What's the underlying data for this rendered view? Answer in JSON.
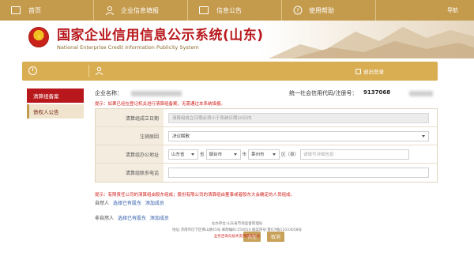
{
  "nav": {
    "items": [
      {
        "label": "首页",
        "icon": "home-icon"
      },
      {
        "label": "企业信息填报",
        "icon": "person-icon"
      },
      {
        "label": "信息公告",
        "icon": "document-icon"
      },
      {
        "label": "使用帮助",
        "icon": "help-icon"
      }
    ],
    "right_label": "导航"
  },
  "banner": {
    "title_cn": "国家企业信用信息公示系统(山东)",
    "title_en": "National Enterprise Credit Information Publicity System"
  },
  "goldbar": {
    "logout_label": "退出登录"
  },
  "sidebar": {
    "items": [
      {
        "label": "清算组备案",
        "active": true
      },
      {
        "label": "债权人公告",
        "active": false
      }
    ]
  },
  "company": {
    "name_label": "企业名称：",
    "uscc_label": "统一社会信用代码/注册号：",
    "uscc_value": "9137068"
  },
  "tips": {
    "tip1": "提示：如果已经在登记机关进行清算组备案，无需通过本系统填报。",
    "tip2": "提示：有限责任公司的清算组由股东组成；股份有限公司的清算组由董事或者股东大会确定的人员组成。"
  },
  "form": {
    "date_label": "清算组成立日期",
    "date_placeholder": "清算组成立日期必须小于系统日期10日内",
    "reason_label": "注销原因",
    "reason_value": "决议解散",
    "address_label": "清算组办公地址",
    "province": "山东省",
    "province_unit": "省",
    "city": "烟台市",
    "city_unit": "市",
    "district": "莱州市",
    "district_unit": "区（县）",
    "detail_placeholder": "请填写详细信息",
    "phone_label": "清算组联系电话"
  },
  "members": {
    "natural_label": "自然人",
    "natural_existing": "选择已有股东",
    "natural_add": "添加成员",
    "nonnatural_label": "非自然人",
    "nonnatural_existing": "选择已有股东",
    "nonnatural_add": "添加成员"
  },
  "buttons": {
    "submit": "预览",
    "cancel": "取消"
  },
  "footer": {
    "line1": "主办单位:山东省市场监督管理局",
    "line2": "地址:济南市历下区佛山路45号   邮政编码:250014   备案序号:鲁ICP备11033058号",
    "line3": "业务咨询与技术支持联系方式"
  },
  "colors": {
    "nav_gold": "#c49a4c",
    "bar_gold": "#d9ad52",
    "accent_red": "#b8181c",
    "link_blue": "#2e5aa8"
  }
}
